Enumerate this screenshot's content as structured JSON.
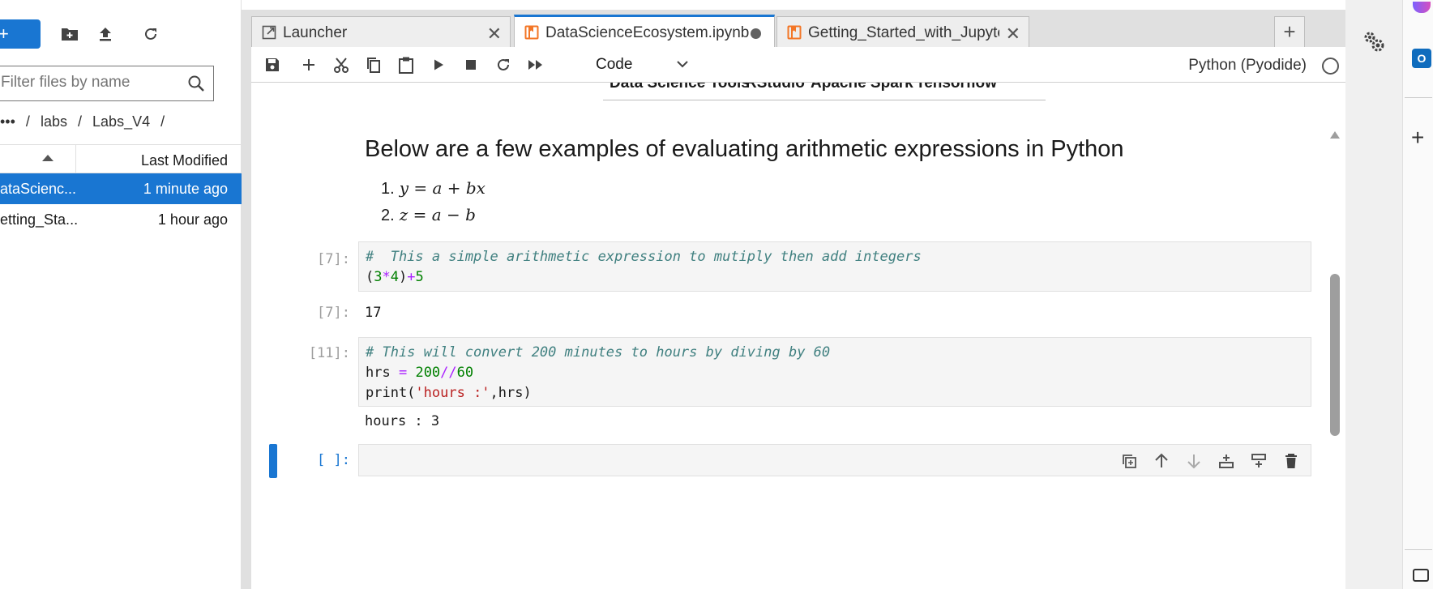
{
  "file_browser": {
    "new_label": "+",
    "filter_placeholder": "Filter files by name",
    "breadcrumb": [
      "•••",
      "/",
      "labs",
      "/",
      "Labs_V4",
      "/"
    ],
    "header": {
      "last_modified": "Last Modified"
    },
    "files": [
      {
        "name": "DataScienceEcosystem.ipynb",
        "display": "ataScienc...",
        "modified": "1 minute ago",
        "selected": true
      },
      {
        "name": "Getting_Started_with_Jupyter.ipynb",
        "display": "etting_Sta...",
        "modified": "1 hour ago",
        "selected": false
      }
    ]
  },
  "tabs": [
    {
      "label": "Launcher",
      "icon": "launcher-icon",
      "active": false
    },
    {
      "label": "DataScienceEcosystem.ipynb",
      "icon": "notebook-icon",
      "active": true,
      "modified": true
    },
    {
      "label": "Getting_Started_with_Jupyter",
      "icon": "notebook-icon",
      "active": false
    }
  ],
  "toolbar": {
    "cell_type": "Code",
    "kernel": "Python (Pyodide)"
  },
  "notebook": {
    "table_row": [
      "Data Science Tools",
      "RStudio",
      "Apache Spark",
      "Tensorflow"
    ],
    "heading": "Below are a few examples of evaluating arithmetic expressions in Python",
    "list": [
      {
        "num": "1.",
        "expr": "y = a + bx"
      },
      {
        "num": "2.",
        "expr": "z = a − b"
      }
    ],
    "cells": [
      {
        "prompt": "[7]:",
        "comment": "#  This a simple arithmetic expression to mutiply then add integers",
        "out_prompt": "[7]:",
        "output": "17"
      },
      {
        "prompt": "[11]:",
        "comment": "# This will convert 200 minutes to hours by diving by 60",
        "output": "hours : 3"
      },
      {
        "prompt": "[ ]:"
      }
    ]
  },
  "colors": {
    "accent": "#1976d2",
    "comment": "#408080",
    "number": "#008000",
    "operator": "#aa22ff",
    "string": "#ba2121"
  }
}
